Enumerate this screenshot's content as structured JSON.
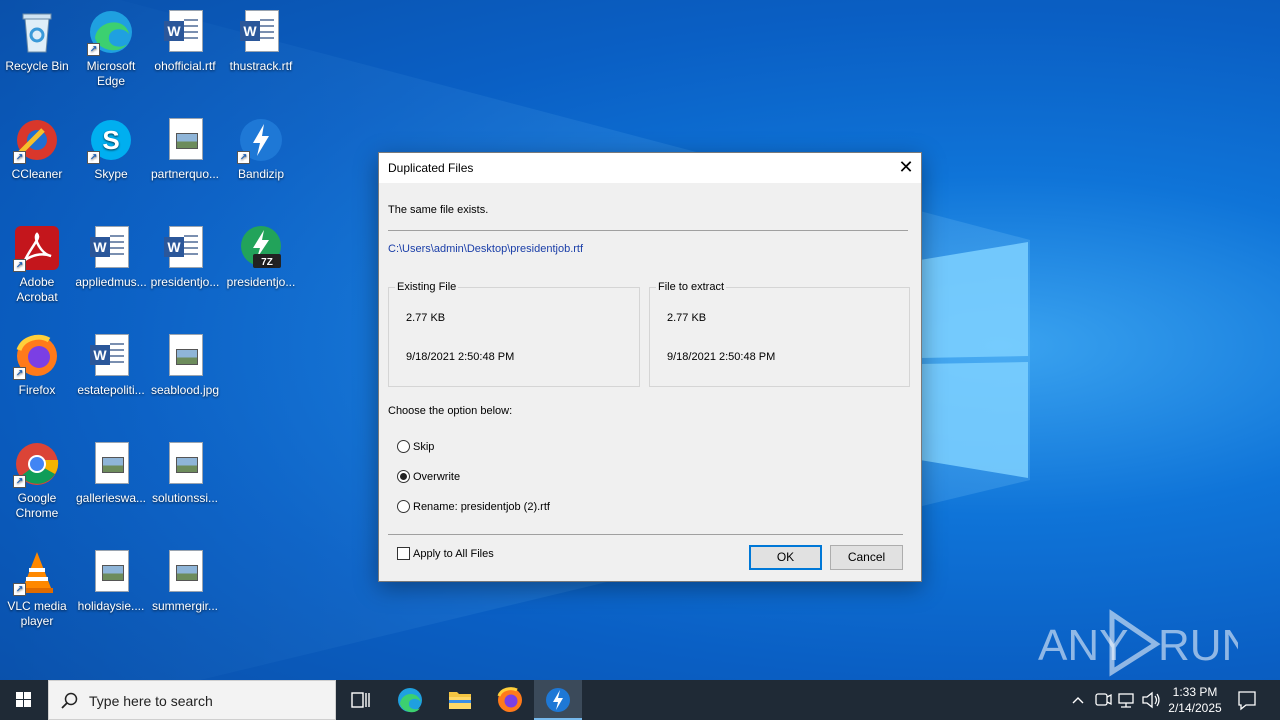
{
  "desktop": {
    "icons": [
      {
        "label": "Recycle Bin",
        "icon": "recycle-bin-icon"
      },
      {
        "label": "Microsoft Edge",
        "icon": "edge-icon"
      },
      {
        "label": "ohofficial.rtf",
        "icon": "word-document-icon"
      },
      {
        "label": "thustrack.rtf",
        "icon": "word-document-icon"
      },
      {
        "label": "CCleaner",
        "icon": "ccleaner-icon"
      },
      {
        "label": "Skype",
        "icon": "skype-icon"
      },
      {
        "label": "partnerquo...",
        "icon": "image-file-icon"
      },
      {
        "label": "Bandizip",
        "icon": "bandizip-icon"
      },
      {
        "label": "Adobe Acrobat",
        "icon": "acrobat-icon"
      },
      {
        "label": "appliedmus...",
        "icon": "word-document-icon"
      },
      {
        "label": "presidentjo...",
        "icon": "word-document-icon"
      },
      {
        "label": "presidentjo...",
        "icon": "7zip-archive-icon"
      },
      {
        "label": "Firefox",
        "icon": "firefox-icon"
      },
      {
        "label": "estatepoliti...",
        "icon": "word-document-icon"
      },
      {
        "label": "seablood.jpg",
        "icon": "image-file-icon"
      },
      {
        "label": "Google Chrome",
        "icon": "chrome-icon"
      },
      {
        "label": "gallerieswa...",
        "icon": "image-file-icon"
      },
      {
        "label": "solutionssi...",
        "icon": "image-file-icon"
      },
      {
        "label": "VLC media player",
        "icon": "vlc-icon"
      },
      {
        "label": "holidaysie....",
        "icon": "image-file-icon"
      },
      {
        "label": "summergir...",
        "icon": "image-file-icon"
      }
    ]
  },
  "dialog": {
    "title": "Duplicated Files",
    "message": "The same file exists.",
    "path": "C:\\Users\\admin\\Desktop\\presidentjob.rtf",
    "existing": {
      "title": "Existing File",
      "size": "2.77 KB",
      "date": "9/18/2021 2:50:48 PM"
    },
    "extract": {
      "title": "File to extract",
      "size": "2.77 KB",
      "date": "9/18/2021 2:50:48 PM"
    },
    "choose_label": "Choose the option below:",
    "options": [
      {
        "label": "Skip",
        "checked": false
      },
      {
        "label": "Overwrite",
        "checked": true
      },
      {
        "label": "Rename: presidentjob (2).rtf",
        "checked": false
      }
    ],
    "apply_all_label": "Apply to All Files",
    "ok_label": "OK",
    "cancel_label": "Cancel"
  },
  "taskbar": {
    "search_placeholder": "Type here to search",
    "apps": [
      "task-view-icon",
      "edge-icon",
      "file-explorer-icon",
      "firefox-icon",
      "bandizip-icon"
    ],
    "active_app": "bandizip-icon",
    "time": "1:33 PM",
    "date": "2/14/2025"
  },
  "watermark": {
    "text_left": "ANY",
    "text_right": "RUN"
  }
}
